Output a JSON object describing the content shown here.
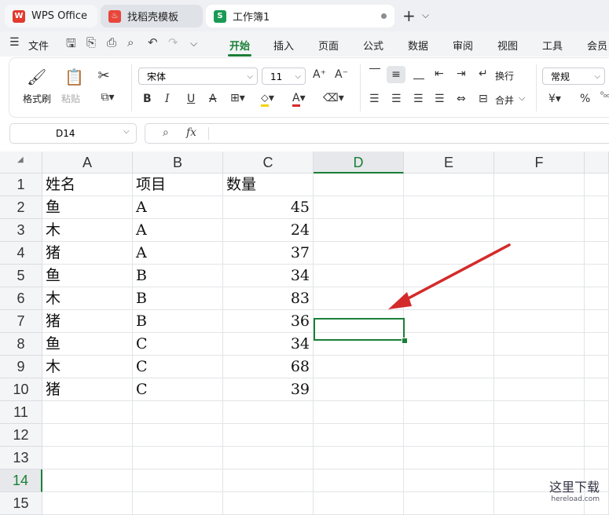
{
  "tabs": [
    {
      "label": "WPS Office"
    },
    {
      "label": "找稻壳模板"
    },
    {
      "label": "工作簿1"
    }
  ],
  "menu": {
    "file": "文件",
    "items": [
      "开始",
      "插入",
      "页面",
      "公式",
      "数据",
      "审阅",
      "视图",
      "工具",
      "会员"
    ]
  },
  "ribbon": {
    "format_painter": "格式刷",
    "paste": "粘贴",
    "font_name": "宋体",
    "font_size": "11",
    "wrap": "换行",
    "merge": "合并",
    "number_format": "常规",
    "currency_symbol": "¥",
    "percent_symbol": "%"
  },
  "formula_bar": {
    "name_box": "D14",
    "fx": "fx",
    "formula": ""
  },
  "columns": [
    "A",
    "B",
    "C",
    "D",
    "E",
    "F"
  ],
  "rows": [
    "1",
    "2",
    "3",
    "4",
    "5",
    "6",
    "7",
    "8",
    "9",
    "10",
    "11",
    "12",
    "13",
    "14",
    "15"
  ],
  "cells": {
    "header": [
      "姓名",
      "项目",
      "数量"
    ],
    "data": [
      [
        "鱼",
        "A",
        "45"
      ],
      [
        "木",
        "A",
        "24"
      ],
      [
        "猪",
        "A",
        "37"
      ],
      [
        "鱼",
        "B",
        "34"
      ],
      [
        "木",
        "B",
        "83"
      ],
      [
        "猪",
        "B",
        "36"
      ],
      [
        "鱼",
        "C",
        "34"
      ],
      [
        "木",
        "C",
        "68"
      ],
      [
        "猪",
        "C",
        "39"
      ]
    ]
  },
  "watermark": {
    "text": "这里下载",
    "url": "hereload.com"
  },
  "colors": {
    "accent": "#1a7f37",
    "arrow": "#d42a2a"
  }
}
